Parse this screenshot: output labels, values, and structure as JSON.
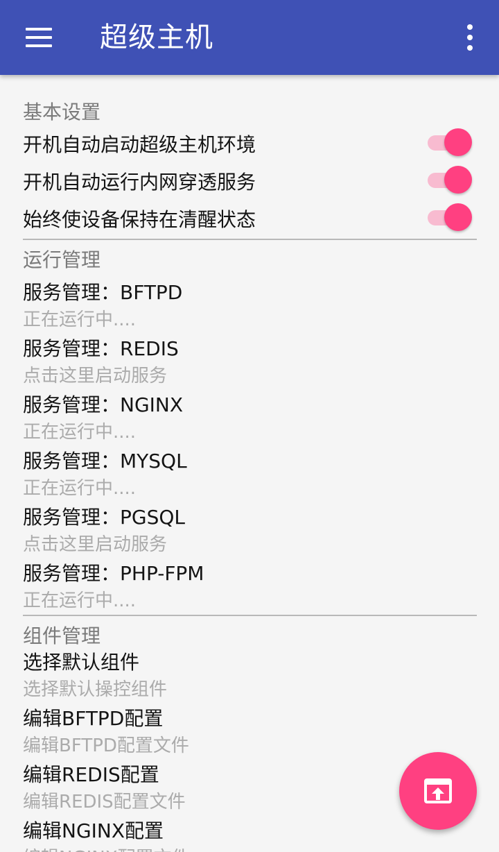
{
  "app_bar": {
    "title": "超级主机",
    "menu_icon": "hamburger-menu-icon",
    "overflow_icon": "more-vert-icon"
  },
  "basic_settings": {
    "category": "基本设置",
    "items": [
      {
        "label": "开机自动启动超级主机环境",
        "enabled": true
      },
      {
        "label": "开机自动运行内网穿透服务",
        "enabled": true
      },
      {
        "label": "始终使设备保持在清醒状态",
        "enabled": true
      }
    ]
  },
  "run_management": {
    "category": "运行管理",
    "services": [
      {
        "title": "服务管理：BFTPD",
        "status": "正在运行中...."
      },
      {
        "title": "服务管理：REDIS",
        "status": "点击这里启动服务"
      },
      {
        "title": "服务管理：NGINX",
        "status": "正在运行中...."
      },
      {
        "title": "服务管理：MYSQL",
        "status": "正在运行中...."
      },
      {
        "title": "服务管理：PGSQL",
        "status": "点击这里启动服务"
      },
      {
        "title": "服务管理：PHP-FPM",
        "status": "正在运行中...."
      }
    ]
  },
  "component_management": {
    "category": "组件管理",
    "items": [
      {
        "title": "选择默认组件",
        "summary": "选择默认操控组件"
      },
      {
        "title": "编辑BFTPD配置",
        "summary": "编辑BFTPD配置文件"
      },
      {
        "title": "编辑REDIS配置",
        "summary": "编辑REDIS配置文件"
      },
      {
        "title": "编辑NGINX配置",
        "summary": "编辑NGINX配置文件"
      }
    ]
  },
  "fab": {
    "icon": "open-in-browser-icon"
  },
  "colors": {
    "primary": "#3f51b5",
    "accent": "#ff4081",
    "switch_track": "#f8bbd0"
  }
}
